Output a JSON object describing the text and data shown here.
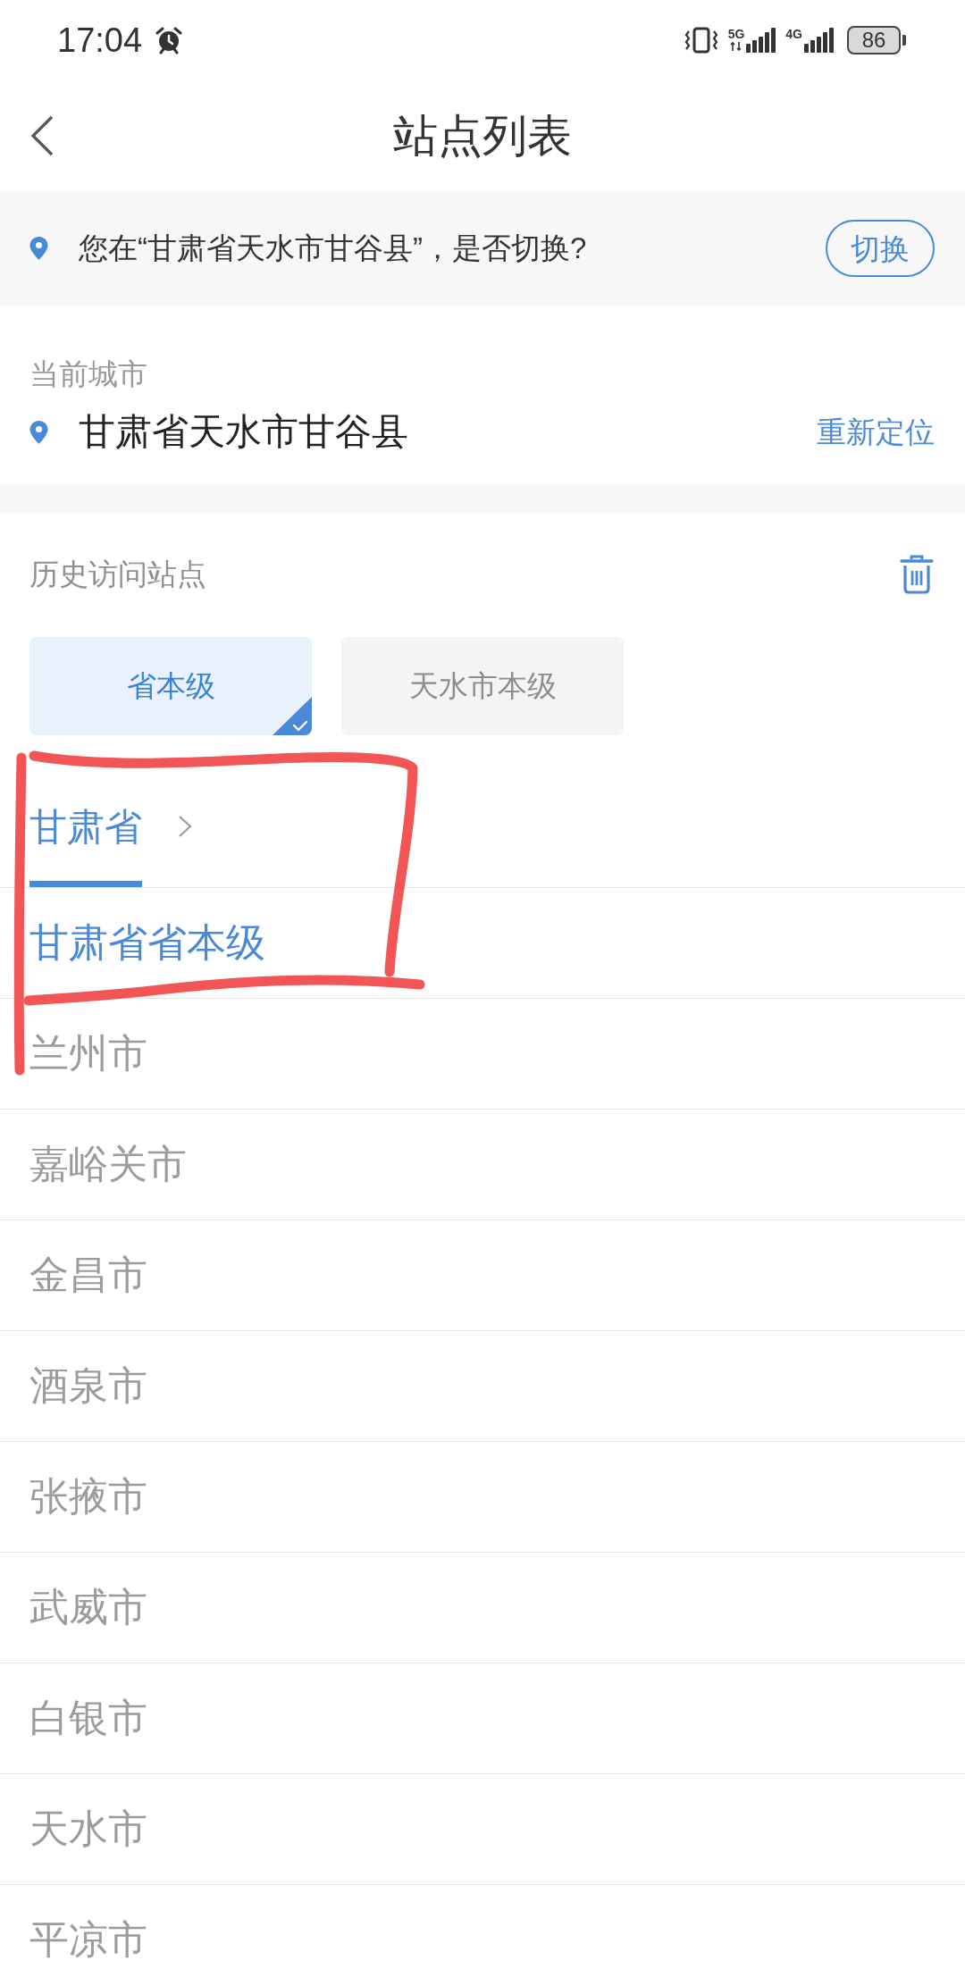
{
  "status_bar": {
    "time": "17:04",
    "network_1": "5G",
    "network_2": "4G",
    "battery": "86"
  },
  "header": {
    "title": "站点列表"
  },
  "location_prompt": {
    "message": "您在“甘肃省天水市甘谷县”，是否切换?",
    "button": "切换"
  },
  "current_city": {
    "label": "当前城市",
    "city": "甘肃省天水市甘谷县",
    "action": "重新定位"
  },
  "history": {
    "label": "历史访问站点",
    "sites": [
      {
        "name": "省本级",
        "selected": true
      },
      {
        "name": "天水市本级",
        "selected": false
      }
    ]
  },
  "breadcrumb_tabs": [
    {
      "label": "甘肃省",
      "selected": true
    }
  ],
  "regions": [
    {
      "name": "甘肃省省本级",
      "selected": true
    },
    {
      "name": "兰州市",
      "selected": false
    },
    {
      "name": "嘉峪关市",
      "selected": false
    },
    {
      "name": "金昌市",
      "selected": false
    },
    {
      "name": "酒泉市",
      "selected": false
    },
    {
      "name": "张掖市",
      "selected": false
    },
    {
      "name": "武威市",
      "selected": false
    },
    {
      "name": "白银市",
      "selected": false
    },
    {
      "name": "天水市",
      "selected": false
    },
    {
      "name": "平凉市",
      "selected": false
    }
  ],
  "annotations": [
    {
      "kind": "freehand-box"
    }
  ]
}
